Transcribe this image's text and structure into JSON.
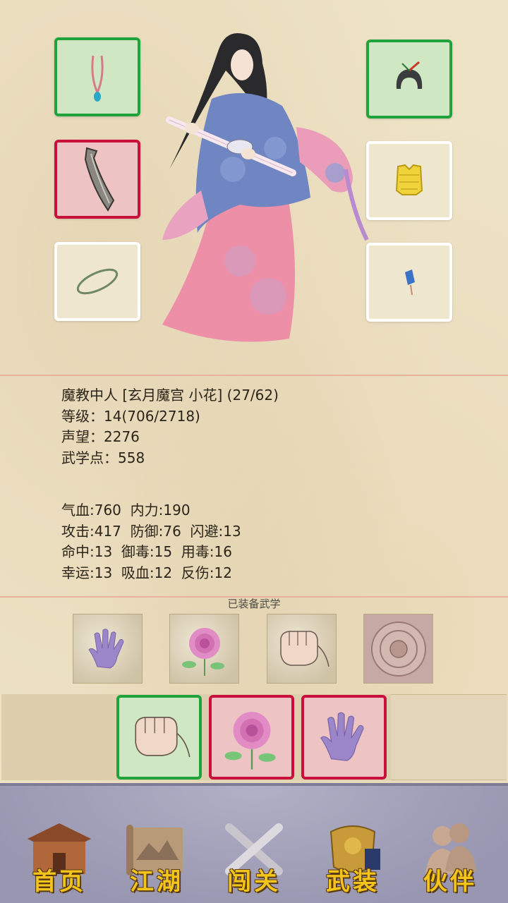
{
  "equipment": {
    "left": [
      {
        "icon": "necklace-icon",
        "state": "green"
      },
      {
        "icon": "weapon-blade-icon",
        "state": "red"
      },
      {
        "icon": "bracelet-icon",
        "state": "empty"
      }
    ],
    "right": [
      {
        "icon": "headwear-icon",
        "state": "green"
      },
      {
        "icon": "armor-vest-icon",
        "state": "empty"
      },
      {
        "icon": "pendant-icon",
        "state": "empty"
      }
    ]
  },
  "character": {
    "title_line": "魔教中人 [玄月魔宫 小花] (27/62)",
    "level": "等级：14(706/2718)",
    "reputation": "声望：2276",
    "martial_points": "武学点：558"
  },
  "stats": {
    "line1": "气血:760  内力:190",
    "line2": "攻击:417  防御:76  闪避:13",
    "line3": "命中:13  御毒:15  用毒:16",
    "line4": "幸运:13  吸血:12  反伤:12"
  },
  "equipped_martial": {
    "title": "已装备武学",
    "skills": [
      "palm-icon",
      "rose-icon",
      "fist-icon",
      "medallion-icon"
    ]
  },
  "skill_bar": [
    {
      "icon": "fist-icon",
      "state": "green"
    },
    {
      "icon": "rose-icon",
      "state": "red"
    },
    {
      "icon": "palm-icon",
      "state": "red"
    }
  ],
  "nav": [
    {
      "label": "首页",
      "icon": "house-icon"
    },
    {
      "label": "江湖",
      "icon": "scroll-map-icon"
    },
    {
      "label": "闯关",
      "icon": "crossed-swords-icon"
    },
    {
      "label": "武装",
      "icon": "armor-icon"
    },
    {
      "label": "伙伴",
      "icon": "companions-icon"
    }
  ],
  "colors": {
    "equipped": "#1fa33a",
    "selected": "#c8103a",
    "nav_text": "#f2c41c"
  }
}
